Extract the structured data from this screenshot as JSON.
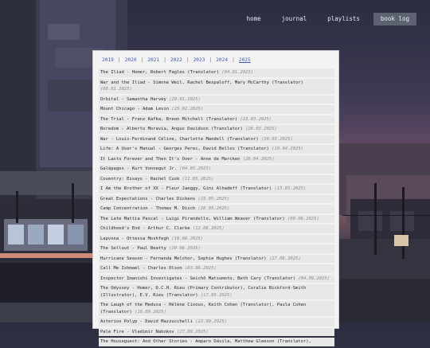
{
  "nav": {
    "items": [
      {
        "label": "home",
        "active": false
      },
      {
        "label": "journal",
        "active": false
      },
      {
        "label": "playlists",
        "active": false
      },
      {
        "label": "book log",
        "active": true
      }
    ]
  },
  "years": [
    "2019",
    "2020",
    "2021",
    "2022",
    "2023",
    "2024",
    "2025"
  ],
  "current_year": "2025",
  "books": [
    {
      "title": "The Iliad - Homer, Robert Fagles (Translator)",
      "date": "(04.01.2025)"
    },
    {
      "title": "War and the Iliad - Simone Weil, Rachel Bespaloff, Mary McCarthy (Translator)",
      "date": "(08.01.2025)"
    },
    {
      "title": "Orbital - Samantha Harvey",
      "date": "(19.01.2025)"
    },
    {
      "title": "Mount Chicago - Adam Levin",
      "date": "(25.02.2025)"
    },
    {
      "title": "The Trial - Franz Kafka, Breon Mitchell (Translator)",
      "date": "(23.03.2025)"
    },
    {
      "title": "Boredom - Alberto Moravia, Angus Davidson (Translator)",
      "date": "(28.03.2025)"
    },
    {
      "title": "War - Louis-Ferdinand Céline, Charlotte Mandell (Translator)",
      "date": "(30.03.2025)"
    },
    {
      "title": "Life: A User's Manual - Georges Perec, David Bellos (Translator)",
      "date": "(19.04.2025)"
    },
    {
      "title": "It Lasts Forever and Then It's Over - Anne de Marcken",
      "date": "(28.04.2025)"
    },
    {
      "title": "Galápagos - Kurt Vonnegut Jr.",
      "date": "(04.05.2025)"
    },
    {
      "title": "Coventry: Essays - Rachel Cusk",
      "date": "(11.05.2025)"
    },
    {
      "title": "I Am the Brother of XX - Fleur Jaeggy, Gini Alhadeff (Translator)",
      "date": "(13.05.2025)"
    },
    {
      "title": "Great Expectations - Charles Dickens",
      "date": "(23.05.2025)"
    },
    {
      "title": "Camp Concentration - Thomas M. Disch",
      "date": "(28.05.2025)"
    },
    {
      "title": "The Late Mattia Pascal - Luigi Pirandello, William Weaver (Translator)",
      "date": "(09.06.2025)"
    },
    {
      "title": "Childhood's End - Arthur C. Clarke",
      "date": "(12.06.2025)"
    },
    {
      "title": "Lapvona - Ottessa Moshfegh",
      "date": "(18.06.2025)"
    },
    {
      "title": "The Sellout - Paul Beatty",
      "date": "(20.06.2025)"
    },
    {
      "title": "Hurricane Season - Fernanda Melchor, Sophie Hughes (Translator)",
      "date": "(27.06.2025)"
    },
    {
      "title": "Call Me Ishmael - Charles Olson",
      "date": "(03.06.2025)"
    },
    {
      "title": "Inspector Imanishi Investigates - Seichō Matsumoto, Beth Cary (Translator)",
      "date": "(04.09.2025)"
    },
    {
      "title": "The Odyssey - Homer, D.C.H. Rieu (Primary Contributor), Coralie Bickford-Smith (Illustrator), E.V. Rieu (Translator)",
      "date": "(17.09.2025)"
    },
    {
      "title": "The Laugh of the Medusa - Hélène Cixous, Keith Cohen (Translator), Paula Cohen (Translator)",
      "date": "(18.09.2025)"
    },
    {
      "title": "Asterios Polyp - David Mazzucchelli",
      "date": "(22.09.2025)"
    },
    {
      "title": "Pale Fire - Vladimir Nabokov",
      "date": "(27.09.2025)"
    },
    {
      "title": "The Houseguest: And Other Stories - Amparo Dávila, Matthew Gleeson (Translator),",
      "date": ""
    }
  ]
}
